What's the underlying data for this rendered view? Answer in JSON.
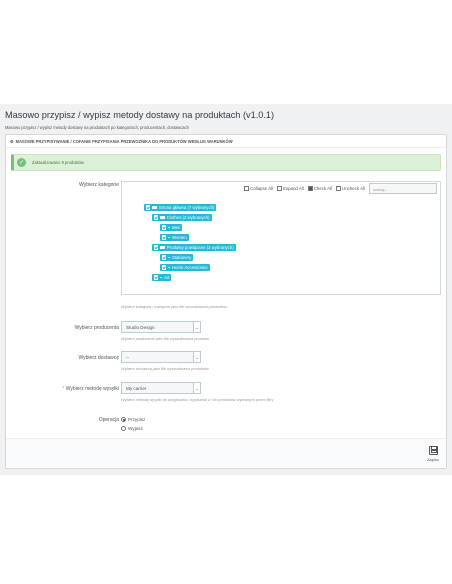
{
  "header": {
    "title": "Masowo przypisz / wypisz metody dostawy na produktach (v1.0.1)",
    "subtitle": "Masowo przypisz / wypisz metody dostawy na produktach po kategoriach, producentach, dostawcach"
  },
  "panel": {
    "heading": "MASOWE PRZYPISYWANIE / COFANIE PRZYPISANIA PRZEWOŹNIKA DO PRODUKTÓW WEDŁUG WARUNKÓW",
    "alert": "Zaktualizowano 9 produktów"
  },
  "category": {
    "label": "Wybierz kategorie",
    "collapse_all": "Collapse All",
    "expand_all": "Expand All",
    "check_all": "Check All",
    "uncheck_all": "Uncheck All",
    "search_placeholder": "szukaj...",
    "nodes": [
      {
        "label": "Strona główna (7 wybranych)"
      },
      {
        "label": "Clothes (2 wybranych)"
      },
      {
        "label": "Men"
      },
      {
        "label": "Women"
      },
      {
        "label": "Produkty powiązane (2 wybranych)"
      },
      {
        "label": "Stationery"
      },
      {
        "label": "Home Accessories"
      },
      {
        "label": "Art"
      }
    ],
    "help": "Wybierz kategorię / kategorie jako filtr wyszukiwania produktów"
  },
  "manufacturer": {
    "label": "Wybierz producenta",
    "value": "Studio Design",
    "help": "Wybierz producenta jako filtr wyszukiwania produktu"
  },
  "supplier": {
    "label": "Wybierz dostawcę",
    "value": "--",
    "help": "Wybierz dostawcę jako filtr wyszukiwania produktów"
  },
  "carrier": {
    "required_mark": "*",
    "label": "Wybierz metodę wysyłki",
    "value": "My carrier",
    "help": "Wybierz metodę wysyłki do przypisania / wypisania z / do produktów wybranych przez filtry"
  },
  "operation": {
    "label": "Operacja",
    "options": [
      {
        "label": "Przypisz",
        "selected": true
      },
      {
        "label": "Wypisz",
        "selected": false
      }
    ]
  },
  "footer": {
    "save_label": "Zapisz"
  },
  "colors": {
    "accent": "#25b9d7",
    "success": "#72c279",
    "background": "#eff1f2"
  }
}
